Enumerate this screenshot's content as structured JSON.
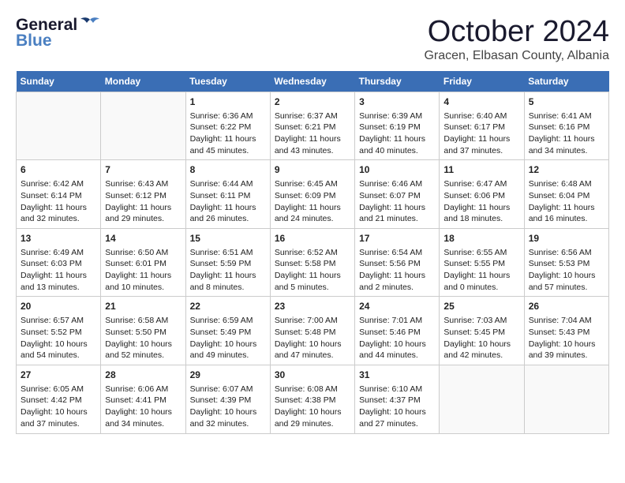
{
  "header": {
    "logo_general": "General",
    "logo_blue": "Blue",
    "month_title": "October 2024",
    "subtitle": "Gracen, Elbasan County, Albania"
  },
  "days_of_week": [
    "Sunday",
    "Monday",
    "Tuesday",
    "Wednesday",
    "Thursday",
    "Friday",
    "Saturday"
  ],
  "weeks": [
    [
      {
        "day": "",
        "sunrise": "",
        "sunset": "",
        "daylight": ""
      },
      {
        "day": "",
        "sunrise": "",
        "sunset": "",
        "daylight": ""
      },
      {
        "day": "1",
        "sunrise": "Sunrise: 6:36 AM",
        "sunset": "Sunset: 6:22 PM",
        "daylight": "Daylight: 11 hours and 45 minutes."
      },
      {
        "day": "2",
        "sunrise": "Sunrise: 6:37 AM",
        "sunset": "Sunset: 6:21 PM",
        "daylight": "Daylight: 11 hours and 43 minutes."
      },
      {
        "day": "3",
        "sunrise": "Sunrise: 6:39 AM",
        "sunset": "Sunset: 6:19 PM",
        "daylight": "Daylight: 11 hours and 40 minutes."
      },
      {
        "day": "4",
        "sunrise": "Sunrise: 6:40 AM",
        "sunset": "Sunset: 6:17 PM",
        "daylight": "Daylight: 11 hours and 37 minutes."
      },
      {
        "day": "5",
        "sunrise": "Sunrise: 6:41 AM",
        "sunset": "Sunset: 6:16 PM",
        "daylight": "Daylight: 11 hours and 34 minutes."
      }
    ],
    [
      {
        "day": "6",
        "sunrise": "Sunrise: 6:42 AM",
        "sunset": "Sunset: 6:14 PM",
        "daylight": "Daylight: 11 hours and 32 minutes."
      },
      {
        "day": "7",
        "sunrise": "Sunrise: 6:43 AM",
        "sunset": "Sunset: 6:12 PM",
        "daylight": "Daylight: 11 hours and 29 minutes."
      },
      {
        "day": "8",
        "sunrise": "Sunrise: 6:44 AM",
        "sunset": "Sunset: 6:11 PM",
        "daylight": "Daylight: 11 hours and 26 minutes."
      },
      {
        "day": "9",
        "sunrise": "Sunrise: 6:45 AM",
        "sunset": "Sunset: 6:09 PM",
        "daylight": "Daylight: 11 hours and 24 minutes."
      },
      {
        "day": "10",
        "sunrise": "Sunrise: 6:46 AM",
        "sunset": "Sunset: 6:07 PM",
        "daylight": "Daylight: 11 hours and 21 minutes."
      },
      {
        "day": "11",
        "sunrise": "Sunrise: 6:47 AM",
        "sunset": "Sunset: 6:06 PM",
        "daylight": "Daylight: 11 hours and 18 minutes."
      },
      {
        "day": "12",
        "sunrise": "Sunrise: 6:48 AM",
        "sunset": "Sunset: 6:04 PM",
        "daylight": "Daylight: 11 hours and 16 minutes."
      }
    ],
    [
      {
        "day": "13",
        "sunrise": "Sunrise: 6:49 AM",
        "sunset": "Sunset: 6:03 PM",
        "daylight": "Daylight: 11 hours and 13 minutes."
      },
      {
        "day": "14",
        "sunrise": "Sunrise: 6:50 AM",
        "sunset": "Sunset: 6:01 PM",
        "daylight": "Daylight: 11 hours and 10 minutes."
      },
      {
        "day": "15",
        "sunrise": "Sunrise: 6:51 AM",
        "sunset": "Sunset: 5:59 PM",
        "daylight": "Daylight: 11 hours and 8 minutes."
      },
      {
        "day": "16",
        "sunrise": "Sunrise: 6:52 AM",
        "sunset": "Sunset: 5:58 PM",
        "daylight": "Daylight: 11 hours and 5 minutes."
      },
      {
        "day": "17",
        "sunrise": "Sunrise: 6:54 AM",
        "sunset": "Sunset: 5:56 PM",
        "daylight": "Daylight: 11 hours and 2 minutes."
      },
      {
        "day": "18",
        "sunrise": "Sunrise: 6:55 AM",
        "sunset": "Sunset: 5:55 PM",
        "daylight": "Daylight: 11 hours and 0 minutes."
      },
      {
        "day": "19",
        "sunrise": "Sunrise: 6:56 AM",
        "sunset": "Sunset: 5:53 PM",
        "daylight": "Daylight: 10 hours and 57 minutes."
      }
    ],
    [
      {
        "day": "20",
        "sunrise": "Sunrise: 6:57 AM",
        "sunset": "Sunset: 5:52 PM",
        "daylight": "Daylight: 10 hours and 54 minutes."
      },
      {
        "day": "21",
        "sunrise": "Sunrise: 6:58 AM",
        "sunset": "Sunset: 5:50 PM",
        "daylight": "Daylight: 10 hours and 52 minutes."
      },
      {
        "day": "22",
        "sunrise": "Sunrise: 6:59 AM",
        "sunset": "Sunset: 5:49 PM",
        "daylight": "Daylight: 10 hours and 49 minutes."
      },
      {
        "day": "23",
        "sunrise": "Sunrise: 7:00 AM",
        "sunset": "Sunset: 5:48 PM",
        "daylight": "Daylight: 10 hours and 47 minutes."
      },
      {
        "day": "24",
        "sunrise": "Sunrise: 7:01 AM",
        "sunset": "Sunset: 5:46 PM",
        "daylight": "Daylight: 10 hours and 44 minutes."
      },
      {
        "day": "25",
        "sunrise": "Sunrise: 7:03 AM",
        "sunset": "Sunset: 5:45 PM",
        "daylight": "Daylight: 10 hours and 42 minutes."
      },
      {
        "day": "26",
        "sunrise": "Sunrise: 7:04 AM",
        "sunset": "Sunset: 5:43 PM",
        "daylight": "Daylight: 10 hours and 39 minutes."
      }
    ],
    [
      {
        "day": "27",
        "sunrise": "Sunrise: 6:05 AM",
        "sunset": "Sunset: 4:42 PM",
        "daylight": "Daylight: 10 hours and 37 minutes."
      },
      {
        "day": "28",
        "sunrise": "Sunrise: 6:06 AM",
        "sunset": "Sunset: 4:41 PM",
        "daylight": "Daylight: 10 hours and 34 minutes."
      },
      {
        "day": "29",
        "sunrise": "Sunrise: 6:07 AM",
        "sunset": "Sunset: 4:39 PM",
        "daylight": "Daylight: 10 hours and 32 minutes."
      },
      {
        "day": "30",
        "sunrise": "Sunrise: 6:08 AM",
        "sunset": "Sunset: 4:38 PM",
        "daylight": "Daylight: 10 hours and 29 minutes."
      },
      {
        "day": "31",
        "sunrise": "Sunrise: 6:10 AM",
        "sunset": "Sunset: 4:37 PM",
        "daylight": "Daylight: 10 hours and 27 minutes."
      },
      {
        "day": "",
        "sunrise": "",
        "sunset": "",
        "daylight": ""
      },
      {
        "day": "",
        "sunrise": "",
        "sunset": "",
        "daylight": ""
      }
    ]
  ]
}
